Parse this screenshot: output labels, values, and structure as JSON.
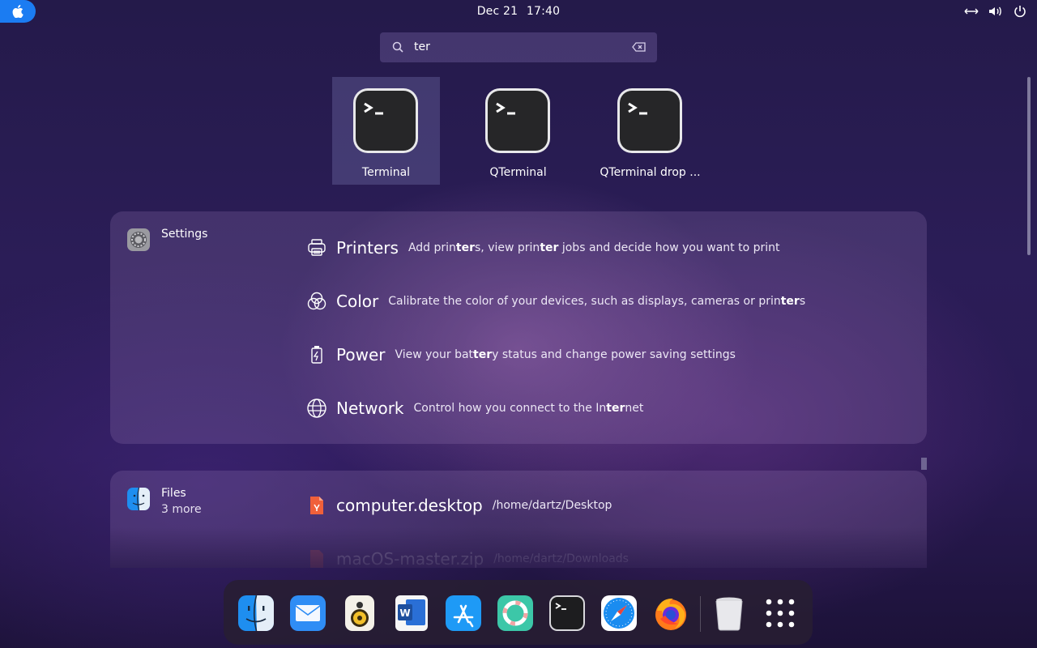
{
  "topbar": {
    "apple_icon": "apple-logo-icon",
    "date": "Dec 21",
    "time": "17:40",
    "tray_icons": [
      "network-icon",
      "volume-icon",
      "power-icon"
    ]
  },
  "search": {
    "query": "ter",
    "icon": "search-icon",
    "clear_icon": "backspace-clear-icon"
  },
  "apps": [
    {
      "label": "Terminal",
      "icon": "terminal-icon",
      "selected": true
    },
    {
      "label": "QTerminal",
      "icon": "terminal-icon",
      "selected": false
    },
    {
      "label": "QTerminal drop ...",
      "icon": "terminal-icon",
      "selected": false
    }
  ],
  "settings_provider": {
    "name": "Settings",
    "icon": "settings-gear-icon",
    "results": [
      {
        "title": "Printers",
        "icon": "printer-icon",
        "desc_parts": [
          "Add prin",
          "ter",
          "s, view prin",
          "ter",
          " jobs and decide how you want to print"
        ]
      },
      {
        "title": "Color",
        "icon": "color-circles-icon",
        "desc_parts": [
          "Calibrate the color of your devices, such as displays, cameras or prin",
          "ter",
          "s"
        ]
      },
      {
        "title": "Power",
        "icon": "power-battery-icon",
        "desc_parts": [
          "View your bat",
          "ter",
          "y status and change power saving settings"
        ]
      },
      {
        "title": "Network",
        "icon": "network-globe-icon",
        "desc_parts": [
          "Control how you connect to the In",
          "ter",
          "net"
        ]
      }
    ]
  },
  "files_provider": {
    "name": "Files",
    "more": "3 more",
    "icon": "finder-icon",
    "results": [
      {
        "title": "computer.desktop",
        "path": "/home/dartz/Desktop",
        "icon": "desktop-file-icon"
      },
      {
        "title": "macOS-master.zip",
        "path": "/home/dartz/Downloads",
        "icon": "zip-file-icon"
      }
    ]
  },
  "dock": {
    "items": [
      {
        "name": "Finder",
        "icon": "finder-icon"
      },
      {
        "name": "Mail",
        "icon": "mail-icon"
      },
      {
        "name": "Rhythmbox",
        "icon": "speaker-icon"
      },
      {
        "name": "Word",
        "icon": "word-icon"
      },
      {
        "name": "App Store",
        "icon": "app-store-icon"
      },
      {
        "name": "Help",
        "icon": "lifebuoy-icon"
      },
      {
        "name": "Terminal",
        "icon": "terminal-icon"
      },
      {
        "name": "Safari",
        "icon": "safari-compass-icon"
      },
      {
        "name": "Firefox",
        "icon": "firefox-icon"
      },
      {
        "name": "Trash",
        "icon": "trash-icon"
      },
      {
        "name": "Show Applications",
        "icon": "app-grid-icon"
      }
    ]
  },
  "colors": {
    "accent": "#1b7cf2",
    "highlight": "#ffffff"
  }
}
